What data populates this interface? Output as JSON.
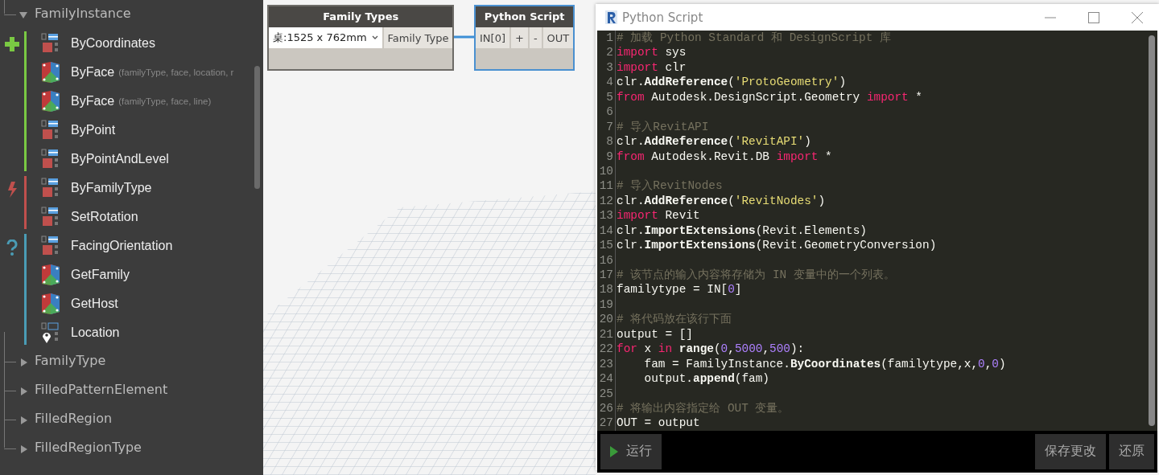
{
  "library": {
    "tree": [
      {
        "label": "FamilyInstance",
        "expanded": true,
        "groups": [
          {
            "kind": "create",
            "color": "#7ac943",
            "items": [
              {
                "name": "ByCoordinates",
                "kind": "grid"
              },
              {
                "name": "ByFace",
                "params": "(familyType, face, location, r",
                "kind": "face"
              },
              {
                "name": "ByFace",
                "params": "(familyType, face, line)",
                "kind": "face"
              },
              {
                "name": "ByPoint",
                "kind": "grid"
              },
              {
                "name": "ByPointAndLevel",
                "kind": "grid"
              }
            ]
          },
          {
            "kind": "action",
            "color": "#c0504d",
            "items": [
              {
                "name": "ByFamilyType",
                "kind": "grid"
              },
              {
                "name": "SetRotation",
                "kind": "grid"
              }
            ]
          },
          {
            "kind": "query",
            "color": "#4a9cb5",
            "items": [
              {
                "name": "FacingOrientation",
                "kind": "grid"
              },
              {
                "name": "GetFamily",
                "kind": "face"
              },
              {
                "name": "GetHost",
                "kind": "face"
              },
              {
                "name": "Location",
                "kind": "pin"
              }
            ]
          }
        ]
      },
      {
        "label": "FamilyType",
        "expanded": false
      },
      {
        "label": "FilledPatternElement",
        "expanded": false
      },
      {
        "label": "FilledRegion",
        "expanded": false
      },
      {
        "label": "FilledRegionType",
        "expanded": false
      }
    ]
  },
  "graph": {
    "nodes": [
      {
        "kind": "selector",
        "title": "Family Types",
        "selected": false,
        "value": "桌:1525 x 762mm",
        "outputs": [
          "Family Type"
        ]
      },
      {
        "kind": "script",
        "title": "Python Script",
        "selected": true,
        "inputs": [
          "IN[0]"
        ],
        "controls": [
          "+",
          "-"
        ],
        "outputs": [
          "OUT"
        ]
      }
    ]
  },
  "editor": {
    "title": "Python Script",
    "lines": [
      {
        "number": "1",
        "tokens": [
          {
            "kind": "comment",
            "text": "# 加载 Python Standard 和 DesignScript 库"
          }
        ]
      },
      {
        "number": "2",
        "tokens": [
          {
            "kind": "keyword",
            "text": "import"
          },
          {
            "kind": "plain",
            "text": " sys"
          }
        ]
      },
      {
        "number": "3",
        "tokens": [
          {
            "kind": "keyword",
            "text": "import"
          },
          {
            "kind": "plain",
            "text": " clr"
          }
        ]
      },
      {
        "number": "4",
        "tokens": [
          {
            "kind": "plain",
            "text": "clr."
          },
          {
            "kind": "method",
            "text": "AddReference"
          },
          {
            "kind": "plain",
            "text": "("
          },
          {
            "kind": "string",
            "text": "'ProtoGeometry'"
          },
          {
            "kind": "plain",
            "text": ")"
          }
        ]
      },
      {
        "number": "5",
        "tokens": [
          {
            "kind": "keyword",
            "text": "from"
          },
          {
            "kind": "plain",
            "text": " Autodesk.DesignScript.Geometry "
          },
          {
            "kind": "keyword",
            "text": "import"
          },
          {
            "kind": "plain",
            "text": " *"
          }
        ]
      },
      {
        "number": "6"
      },
      {
        "number": "7",
        "tokens": [
          {
            "kind": "comment",
            "text": "# 导入RevitAPI"
          }
        ]
      },
      {
        "number": "8",
        "tokens": [
          {
            "kind": "plain",
            "text": "clr."
          },
          {
            "kind": "method",
            "text": "AddReference"
          },
          {
            "kind": "plain",
            "text": "("
          },
          {
            "kind": "string",
            "text": "'RevitAPI'"
          },
          {
            "kind": "plain",
            "text": ")"
          }
        ]
      },
      {
        "number": "9",
        "tokens": [
          {
            "kind": "keyword",
            "text": "from"
          },
          {
            "kind": "plain",
            "text": " Autodesk.Revit.DB "
          },
          {
            "kind": "keyword",
            "text": "import"
          },
          {
            "kind": "plain",
            "text": " *"
          }
        ]
      },
      {
        "number": "10"
      },
      {
        "number": "11",
        "tokens": [
          {
            "kind": "comment",
            "text": "# 导入RevitNodes"
          }
        ]
      },
      {
        "number": "12",
        "tokens": [
          {
            "kind": "plain",
            "text": "clr."
          },
          {
            "kind": "method",
            "text": "AddReference"
          },
          {
            "kind": "plain",
            "text": "("
          },
          {
            "kind": "string",
            "text": "'RevitNodes'"
          },
          {
            "kind": "plain",
            "text": ")"
          }
        ]
      },
      {
        "number": "13",
        "tokens": [
          {
            "kind": "keyword",
            "text": "import"
          },
          {
            "kind": "plain",
            "text": " Revit"
          }
        ]
      },
      {
        "number": "14",
        "tokens": [
          {
            "kind": "plain",
            "text": "clr."
          },
          {
            "kind": "method",
            "text": "ImportExtensions"
          },
          {
            "kind": "plain",
            "text": "(Revit.Elements)"
          }
        ]
      },
      {
        "number": "15",
        "tokens": [
          {
            "kind": "plain",
            "text": "clr."
          },
          {
            "kind": "method",
            "text": "ImportExtensions"
          },
          {
            "kind": "plain",
            "text": "(Revit.GeometryConversion)"
          }
        ]
      },
      {
        "number": "16"
      },
      {
        "number": "17",
        "tokens": [
          {
            "kind": "comment",
            "text": "# 该节点的输入内容将存储为 IN 变量中的一个列表。"
          }
        ]
      },
      {
        "number": "18",
        "tokens": [
          {
            "kind": "plain",
            "text": "familytype = IN["
          },
          {
            "kind": "number",
            "text": "0"
          },
          {
            "kind": "plain",
            "text": "]"
          }
        ]
      },
      {
        "number": "19"
      },
      {
        "number": "20",
        "tokens": [
          {
            "kind": "comment",
            "text": "# 将代码放在该行下面"
          }
        ]
      },
      {
        "number": "21",
        "tokens": [
          {
            "kind": "plain",
            "text": "output = []"
          }
        ]
      },
      {
        "number": "22",
        "tokens": [
          {
            "kind": "keyword",
            "text": "for"
          },
          {
            "kind": "plain",
            "text": " x "
          },
          {
            "kind": "keyword",
            "text": "in"
          },
          {
            "kind": "method",
            "text": " range"
          },
          {
            "kind": "plain",
            "text": "("
          },
          {
            "kind": "number",
            "text": "0"
          },
          {
            "kind": "plain",
            "text": ","
          },
          {
            "kind": "number",
            "text": "5000"
          },
          {
            "kind": "plain",
            "text": ","
          },
          {
            "kind": "number",
            "text": "500"
          },
          {
            "kind": "plain",
            "text": "):"
          }
        ]
      },
      {
        "number": "23",
        "tokens": [
          {
            "kind": "plain",
            "text": "    fam = FamilyInstance."
          },
          {
            "kind": "method",
            "text": "ByCoordinates"
          },
          {
            "kind": "plain",
            "text": "(familytype,x,"
          },
          {
            "kind": "number",
            "text": "0"
          },
          {
            "kind": "plain",
            "text": ","
          },
          {
            "kind": "number",
            "text": "0"
          },
          {
            "kind": "plain",
            "text": ")"
          }
        ]
      },
      {
        "number": "24",
        "tokens": [
          {
            "kind": "plain",
            "text": "    output."
          },
          {
            "kind": "method",
            "text": "append"
          },
          {
            "kind": "plain",
            "text": "(fam)"
          }
        ]
      },
      {
        "number": "25"
      },
      {
        "number": "26",
        "tokens": [
          {
            "kind": "comment",
            "text": "# 将输出内容指定给 OUT 变量。"
          }
        ]
      },
      {
        "number": "27",
        "tokens": [
          {
            "kind": "plain",
            "text": "OUT = output"
          }
        ]
      }
    ],
    "run_button": "运行",
    "save_button": "保存更改",
    "revert_button": "还原"
  }
}
